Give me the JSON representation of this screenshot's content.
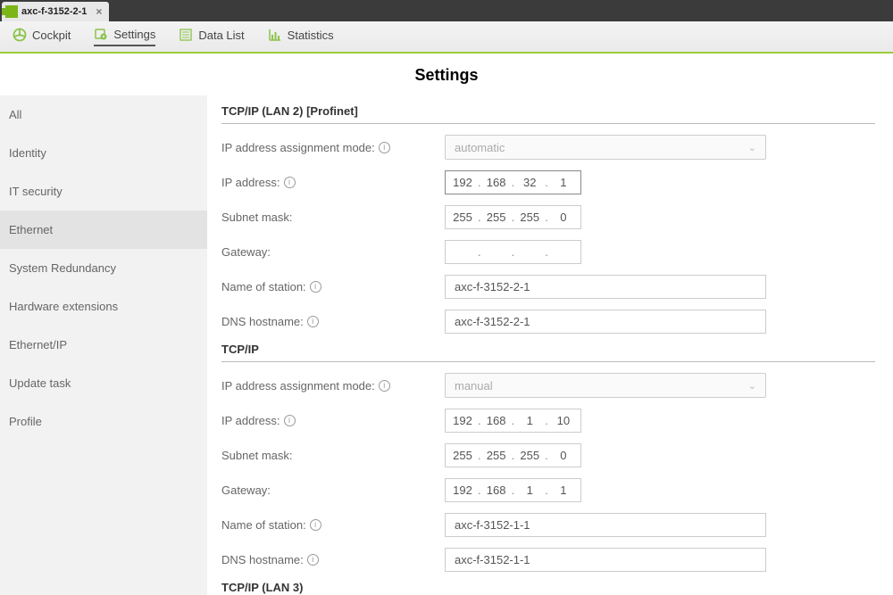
{
  "tab": {
    "title": "axc-f-3152-2-1"
  },
  "menu": {
    "cockpit": "Cockpit",
    "settings": "Settings",
    "datalist": "Data List",
    "statistics": "Statistics"
  },
  "pageTitle": "Settings",
  "sidebar": {
    "items": [
      "All",
      "Identity",
      "IT security",
      "Ethernet",
      "System Redundancy",
      "Hardware extensions",
      "Ethernet/IP",
      "Update task",
      "Profile"
    ],
    "selectedIndex": 3
  },
  "labels": {
    "ipMode": "IP address assignment mode:",
    "ipAddr": "IP address:",
    "subnet": "Subnet mask:",
    "gateway": "Gateway:",
    "station": "Name of station:",
    "dns": "DNS hostname:"
  },
  "sections": [
    {
      "title": "TCP/IP (LAN 2) [Profinet]",
      "mode": "automatic",
      "ip": [
        "192",
        "168",
        "32",
        "1"
      ],
      "subnet": [
        "255",
        "255",
        "255",
        "0"
      ],
      "gateway": [
        "",
        "",
        "",
        ""
      ],
      "station": "axc-f-3152-2-1",
      "dns": "axc-f-3152-2-1",
      "ipDark": true
    },
    {
      "title": "TCP/IP",
      "mode": "manual",
      "ip": [
        "192",
        "168",
        "1",
        "10"
      ],
      "subnet": [
        "255",
        "255",
        "255",
        "0"
      ],
      "gateway": [
        "192",
        "168",
        "1",
        "1"
      ],
      "station": "axc-f-3152-1-1",
      "dns": "axc-f-3152-1-1",
      "ipDark": false
    },
    {
      "title": "TCP/IP (LAN 3)",
      "headerOnly": true
    }
  ]
}
